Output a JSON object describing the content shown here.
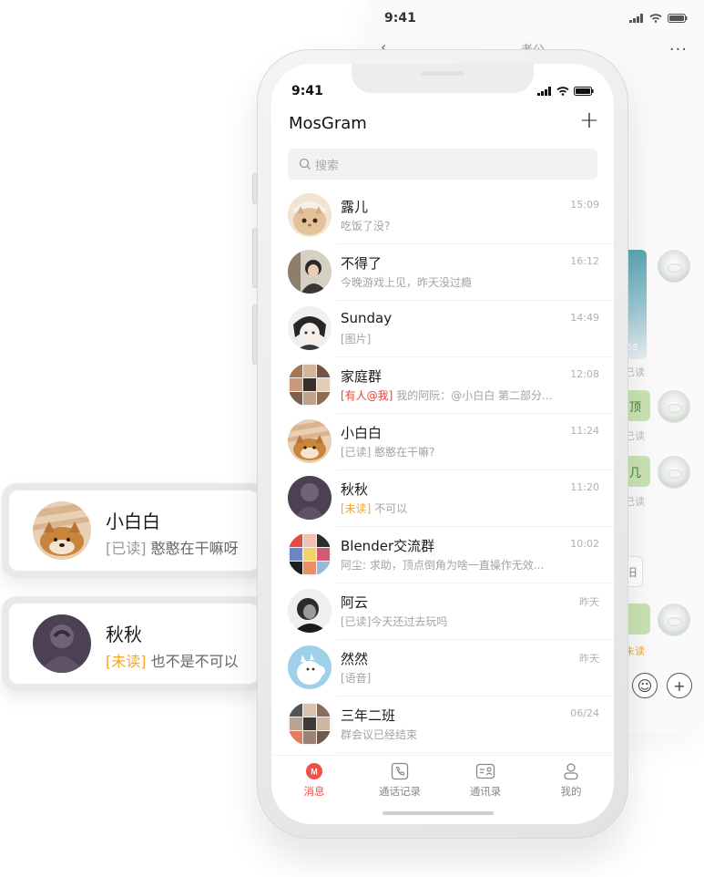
{
  "background_screen": {
    "status_time": "9:41",
    "title": "老公",
    "image_duration": "58",
    "messages": [
      {
        "text": "",
        "status": "已读"
      },
      {
        "text": "顶",
        "status": "已读"
      },
      {
        "text": "几",
        "status": "已读"
      },
      {
        "text": "",
        "status": "未读"
      }
    ],
    "input_text": "旧"
  },
  "floating_cards": [
    {
      "name": "小白白",
      "tag": "[已读]",
      "tag_type": "read",
      "message": " 憨憨在干嘛呀"
    },
    {
      "name": "秋秋",
      "tag": "[未读]",
      "tag_type": "unread",
      "message": " 也不是不可以"
    }
  ],
  "phone": {
    "status_time": "9:41",
    "app_title": "MosGram",
    "add_icon": "plus-icon",
    "search_placeholder": "搜索",
    "chats": [
      {
        "name": "露儿",
        "tag": "",
        "tag_type": "",
        "message": "吃饭了没?",
        "time": "15:09",
        "avatar": "cat"
      },
      {
        "name": "不得了",
        "tag": "",
        "tag_type": "",
        "message": "今晚游戏上见，昨天没过瘾",
        "time": "16:12",
        "avatar": "girl"
      },
      {
        "name": "Sunday",
        "tag": "",
        "tag_type": "",
        "message": "[图片]",
        "time": "14:49",
        "avatar": "anime"
      },
      {
        "name": "家庭群",
        "tag": "[有人@我]",
        "tag_type": "mention",
        "message": " 我的阿阮：@小白白 第二部分...",
        "time": "12:08",
        "avatar": "grid"
      },
      {
        "name": "小白白",
        "tag": "",
        "tag_type": "",
        "message": "[已读] 憨憨在干嘛?",
        "time": "11:24",
        "avatar": "shiba"
      },
      {
        "name": "秋秋",
        "tag": "[未读]",
        "tag_type": "unread",
        "message": " 不可以",
        "time": "11:20",
        "avatar": "dark"
      },
      {
        "name": "Blender交流群",
        "tag": "",
        "tag_type": "",
        "message": "阿尘: 求助，顶点倒角为啥一直操作无效...",
        "time": "10:02",
        "avatar": "grid2"
      },
      {
        "name": "阿云",
        "tag": "",
        "tag_type": "",
        "message": "[已读]今天还过去玩吗",
        "time": "昨天",
        "avatar": "bw"
      },
      {
        "name": "然然",
        "tag": "",
        "tag_type": "",
        "message": "[语音]",
        "time": "昨天",
        "avatar": "moomin"
      },
      {
        "name": "三年二班",
        "tag": "",
        "tag_type": "",
        "message": "群会议已经结束",
        "time": "06/24",
        "avatar": "grid3"
      }
    ],
    "tabs": [
      {
        "label": "消息",
        "icon": "message-icon",
        "active": true
      },
      {
        "label": "通话记录",
        "icon": "phone-icon",
        "active": false
      },
      {
        "label": "通讯录",
        "icon": "contacts-icon",
        "active": false
      },
      {
        "label": "我的",
        "icon": "person-icon",
        "active": false
      }
    ],
    "colors": {
      "accent": "#f0504a",
      "unread": "#f5a623",
      "mention": "#e8443a"
    }
  }
}
